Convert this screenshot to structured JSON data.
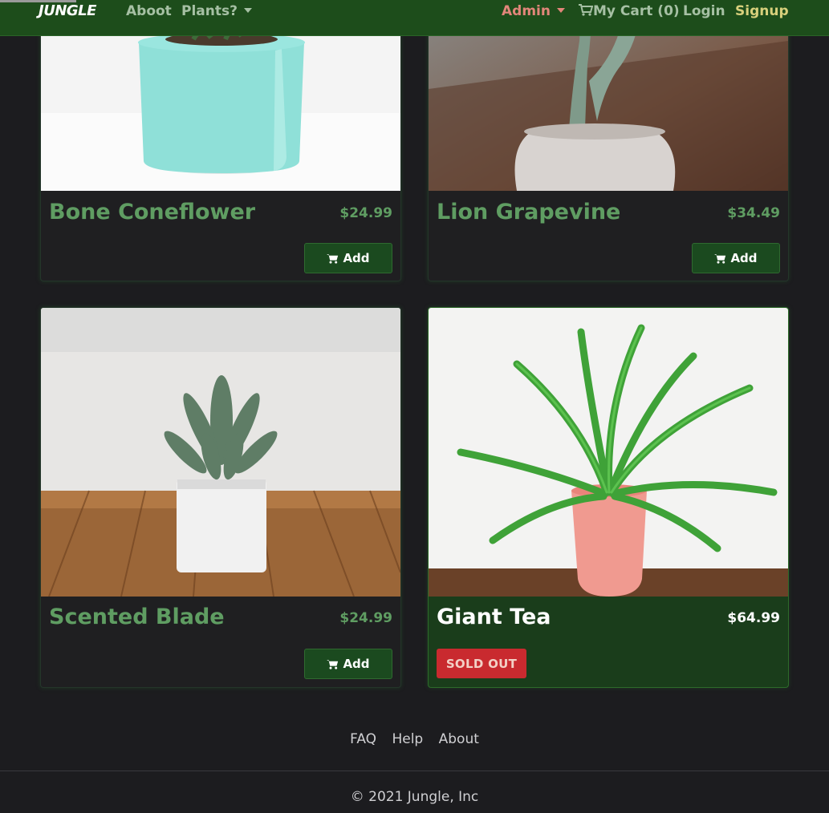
{
  "navbar": {
    "brand": "JUNGLE",
    "about": "Aboot",
    "plants": "Plants?",
    "admin": "Admin",
    "cart": "My Cart (0)",
    "login": "Login",
    "signup": "Signup",
    "icons": {
      "cart": "cart-icon",
      "dropdown": "chevron-down-icon"
    }
  },
  "products": [
    {
      "name": "Bone Coneflower",
      "price": "$24.99",
      "action": "Add"
    },
    {
      "name": "Lion Grapevine",
      "price": "$34.49",
      "action": "Add"
    },
    {
      "name": "Scented Blade",
      "price": "$24.99",
      "action": "Add"
    },
    {
      "name": "Giant Tea",
      "price": "$64.99",
      "status": "SOLD OUT"
    }
  ],
  "footer": {
    "faq": "FAQ",
    "help": "Help",
    "about": "About",
    "copyright": "© 2021 Jungle, Inc"
  },
  "colors": {
    "navbar_bg": "#1d4d1b",
    "page_bg": "#1c1c1f",
    "accent_green": "#5f9d62",
    "admin": "#e2867a",
    "signup": "#d8d07c",
    "sold_out": "#c92a2f"
  }
}
